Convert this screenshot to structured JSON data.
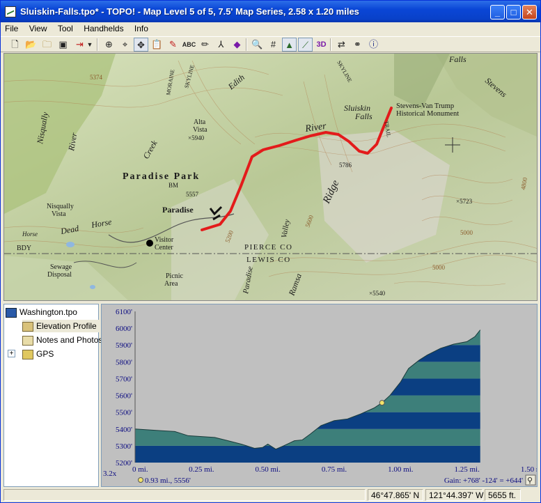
{
  "window": {
    "title": "Sluiskin-Falls.tpo* - TOPO! - Map Level 5 of 5, 7.5' Map Series, 2.58 x 1.20 miles",
    "buttons": {
      "minimize": "_",
      "maximize": "□",
      "close": "✕"
    }
  },
  "menu": [
    "File",
    "View",
    "Tool",
    "Handhelds",
    "Info"
  ],
  "toolbar": {
    "icons": [
      "new-icon",
      "open-icon",
      "open-folder-icon",
      "save-icon",
      "export-icon",
      "dropdown-arrow-icon",
      "zoom-icon",
      "center-icon",
      "move-icon",
      "paste-icon",
      "pin-icon",
      "text-tool-icon",
      "pencil-icon",
      "route-icon",
      "waypoint-icon",
      "magnifier-icon",
      "grid-icon",
      "shaded-relief-icon",
      "profile-tool-icon",
      "3d-view-icon",
      "handheld-icon",
      "find-icon",
      "info-icon"
    ],
    "text_3d": "3D",
    "text_abc": "ABC"
  },
  "map": {
    "labels": [
      {
        "text": "Sluiskin",
        "name": "map-label-sluiskin"
      },
      {
        "text": "Falls",
        "name": "map-label-falls"
      },
      {
        "text": "Stevens-Van Trump",
        "name": "map-label-stevens-van-trump"
      },
      {
        "text": "Historical Monument",
        "name": "map-label-historical-monument"
      },
      {
        "text": "River",
        "name": "map-label-river"
      },
      {
        "text": "Paradise Park",
        "name": "map-label-paradise-park"
      },
      {
        "text": "Paradise",
        "name": "map-label-paradise"
      },
      {
        "text": "Alta",
        "name": "map-label-alta"
      },
      {
        "text": "Vista",
        "name": "map-label-vista"
      },
      {
        "text": "×5940",
        "name": "map-label-5940"
      },
      {
        "text": "Creek",
        "name": "map-label-creek"
      },
      {
        "text": "Edith",
        "name": "map-label-edith"
      },
      {
        "text": "Nisqually",
        "name": "map-label-nisqually"
      },
      {
        "text": "River",
        "name": "map-label-nisqually-river"
      },
      {
        "text": "Nisqually",
        "name": "map-label-nisqually-vista-1"
      },
      {
        "text": "Vista",
        "name": "map-label-nisqually-vista-2"
      },
      {
        "text": "Dead",
        "name": "map-label-dead"
      },
      {
        "text": "Horse",
        "name": "map-label-horse"
      },
      {
        "text": "Visitor",
        "name": "map-label-visitor"
      },
      {
        "text": "Center",
        "name": "map-label-center"
      },
      {
        "text": "PIERCE CO",
        "name": "map-label-pierce-co"
      },
      {
        "text": "LEWIS CO",
        "name": "map-label-lewis-co"
      },
      {
        "text": "Ridge",
        "name": "map-label-ridge"
      },
      {
        "text": "Valley",
        "name": "map-label-valley"
      },
      {
        "text": "Paradise",
        "name": "map-label-paradise-2"
      },
      {
        "text": "Sewage",
        "name": "map-label-sewage"
      },
      {
        "text": "Disposal",
        "name": "map-label-disposal"
      },
      {
        "text": "Picnic",
        "name": "map-label-picnic"
      },
      {
        "text": "Area",
        "name": "map-label-area"
      },
      {
        "text": "×5723",
        "name": "map-label-5723"
      },
      {
        "text": "×5540",
        "name": "map-label-5540"
      },
      {
        "text": "5786",
        "name": "map-label-5786"
      },
      {
        "text": "5557",
        "name": "map-label-5557"
      },
      {
        "text": "BM",
        "name": "map-label-bm"
      },
      {
        "text": "TRAIL",
        "name": "map-label-trail"
      },
      {
        "text": "SKYLINE",
        "name": "map-label-skyline"
      },
      {
        "text": "SKYLINE",
        "name": "map-label-skyline-2"
      },
      {
        "text": "MORAINE",
        "name": "map-label-moraine"
      },
      {
        "text": "Stevens",
        "name": "map-label-stevens"
      },
      {
        "text": "Falls",
        "name": "map-label-falls-2"
      },
      {
        "text": "BDY",
        "name": "map-label-bdy"
      },
      {
        "text": "5000",
        "name": "map-label-5000"
      },
      {
        "text": "5000",
        "name": "map-label-5000-2"
      },
      {
        "text": "5374",
        "name": "map-label-5374"
      },
      {
        "text": "5600",
        "name": "map-label-5600"
      },
      {
        "text": "5200",
        "name": "map-label-5200"
      },
      {
        "text": "4800",
        "name": "map-label-4800"
      },
      {
        "text": "Ramsa",
        "name": "map-label-ramsa"
      },
      {
        "text": "Horse",
        "name": "map-label-horse-2"
      }
    ],
    "route_color": "#e31b1b"
  },
  "tree": {
    "root": "Washington.tpo",
    "items": [
      "Elevation Profile",
      "Notes and Photos",
      "GPS"
    ],
    "expander": "+"
  },
  "profile": {
    "cursor_readout": "0.93 mi., 5556'",
    "gain_readout": "Gain: +768' -124' = +644'",
    "zoom_readout": "3.2x",
    "colors": {
      "band_dark": "#0b3f82",
      "band_light": "#3d7f7a",
      "bg": "#c0c0c0",
      "axis_text": "#0a0a80"
    }
  },
  "chart_data": {
    "type": "area",
    "title": "",
    "xlabel": "",
    "ylabel": "",
    "xlim": [
      0,
      1.5
    ],
    "ylim": [
      5200,
      6100
    ],
    "x_ticks": [
      "0 mi.",
      "0.25 mi.",
      "0.50 mi.",
      "0.75 mi.",
      "1.00 mi.",
      "1.25 mi.",
      "1.50 mi."
    ],
    "y_ticks": [
      "6100'",
      "6000'",
      "5900'",
      "5800'",
      "5700'",
      "5600'",
      "5500'",
      "5400'",
      "5300'",
      "5200'"
    ],
    "series": [
      {
        "x": [
          0,
          0.05,
          0.1,
          0.15,
          0.2,
          0.25,
          0.3,
          0.35,
          0.4,
          0.45,
          0.48,
          0.5,
          0.53,
          0.56,
          0.6,
          0.63,
          0.66,
          0.7,
          0.75,
          0.8,
          0.85,
          0.9,
          0.93,
          0.96,
          1.0,
          1.03,
          1.07,
          1.1,
          1.15,
          1.2,
          1.25,
          1.28,
          1.3
        ],
        "y": [
          5400,
          5395,
          5390,
          5385,
          5360,
          5355,
          5350,
          5330,
          5310,
          5285,
          5290,
          5310,
          5280,
          5300,
          5330,
          5335,
          5370,
          5420,
          5450,
          5460,
          5490,
          5525,
          5556,
          5600,
          5680,
          5760,
          5810,
          5840,
          5880,
          5905,
          5920,
          5950,
          5990
        ]
      }
    ],
    "marker": {
      "x": 0.93,
      "y": 5556
    }
  }
}
